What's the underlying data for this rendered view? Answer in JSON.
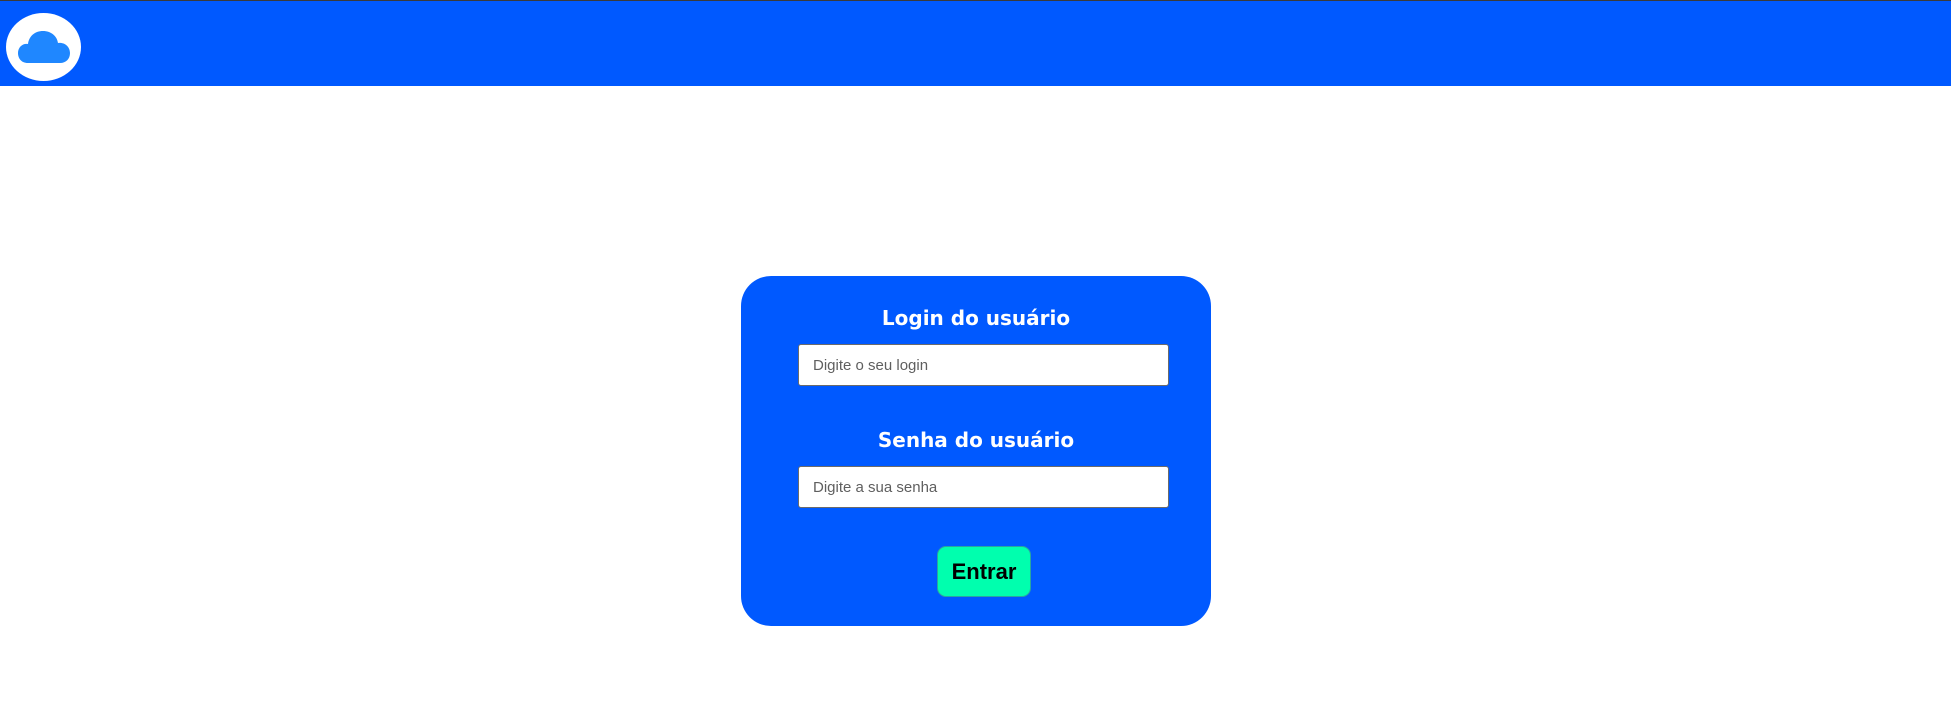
{
  "header": {
    "logo_icon": "cloud-icon",
    "background_color": "#0059ff",
    "logo_color": "#1f87ff"
  },
  "login_form": {
    "background_color": "#0059ff",
    "login_label": "Login do usuário",
    "login_placeholder": "Digite o seu login",
    "login_value": "",
    "password_label": "Senha do usuário",
    "password_placeholder": "Digite a sua senha",
    "password_value": "",
    "submit_label": "Entrar",
    "submit_color": "#00ffae"
  }
}
